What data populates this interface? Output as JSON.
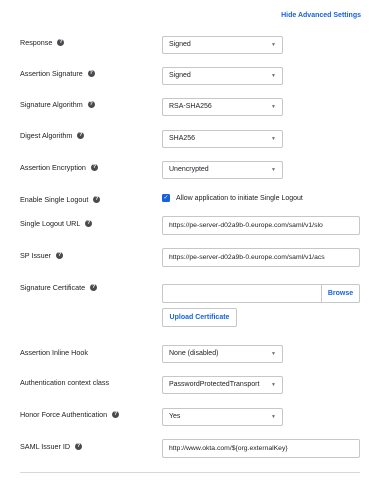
{
  "header": {
    "hide_advanced_label": "Hide Advanced Settings"
  },
  "fields": {
    "response": {
      "label": "Response",
      "value": "Signed"
    },
    "assertion_signature": {
      "label": "Assertion Signature",
      "value": "Signed"
    },
    "signature_algorithm": {
      "label": "Signature Algorithm",
      "value": "RSA-SHA256"
    },
    "digest_algorithm": {
      "label": "Digest Algorithm",
      "value": "SHA256"
    },
    "assertion_encryption": {
      "label": "Assertion Encryption",
      "value": "Unencrypted"
    },
    "enable_single_logout": {
      "label": "Enable Single Logout",
      "checkbox_label": "Allow application to initiate Single Logout",
      "checked": true
    },
    "single_logout_url": {
      "label": "Single Logout URL",
      "value": "https://pe-server-d02a9b-0.europe.com/saml/v1/slo"
    },
    "sp_issuer": {
      "label": "SP Issuer",
      "value": "https://pe-server-d02a9b-0.europe.com/saml/v1/acs"
    },
    "signature_certificate": {
      "label": "Signature Certificate",
      "value": "",
      "browse_label": "Browse",
      "upload_label": "Upload Certificate"
    },
    "assertion_inline_hook": {
      "label": "Assertion Inline Hook",
      "value": "None (disabled)"
    },
    "authentication_context_class": {
      "label": "Authentication context class",
      "value": "PasswordProtectedTransport"
    },
    "honor_force_authentication": {
      "label": "Honor Force Authentication",
      "value": "Yes"
    },
    "saml_issuer_id": {
      "label": "SAML Issuer ID",
      "value": "http://www.okta.com/${org.externalKey}"
    }
  },
  "icons": {
    "help": "help-question-icon",
    "caret": "chevron-down-icon",
    "check": "checkmark-icon"
  },
  "colors": {
    "accent": "#1662dd",
    "help_icon": "#4a4a4f",
    "border": "#c6c6cb"
  }
}
